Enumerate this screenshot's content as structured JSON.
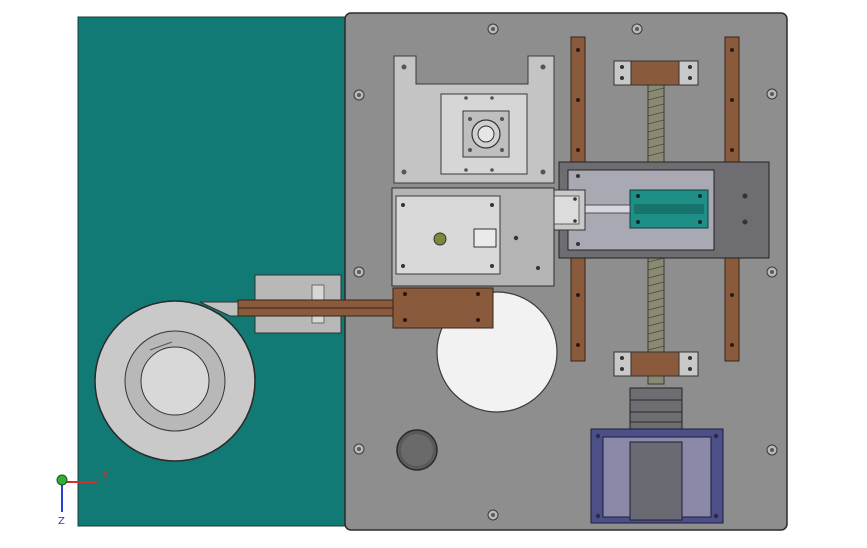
{
  "viewport": {
    "background": "#ffffff"
  },
  "colors": {
    "base_plate": "#8e8e8e",
    "base_plate_edge": "#2b2b2b",
    "side_panel": "#127a74",
    "steel_light": "#c7c7c7",
    "steel_mid": "#a8a8a8",
    "steel_dark": "#6e6e72",
    "copper": "#8a5a3c",
    "teal_block": "#1d8f86",
    "brass": "#b08a2a",
    "motor_blue": "#4d4f88",
    "axis_x": "#d0302a",
    "axis_y": "#2fae3a",
    "axis_z": "#2a3fd0"
  },
  "triad": {
    "x_label": "X",
    "z_label": "Z"
  },
  "icons": [
    "coordinate-triad-icon"
  ]
}
